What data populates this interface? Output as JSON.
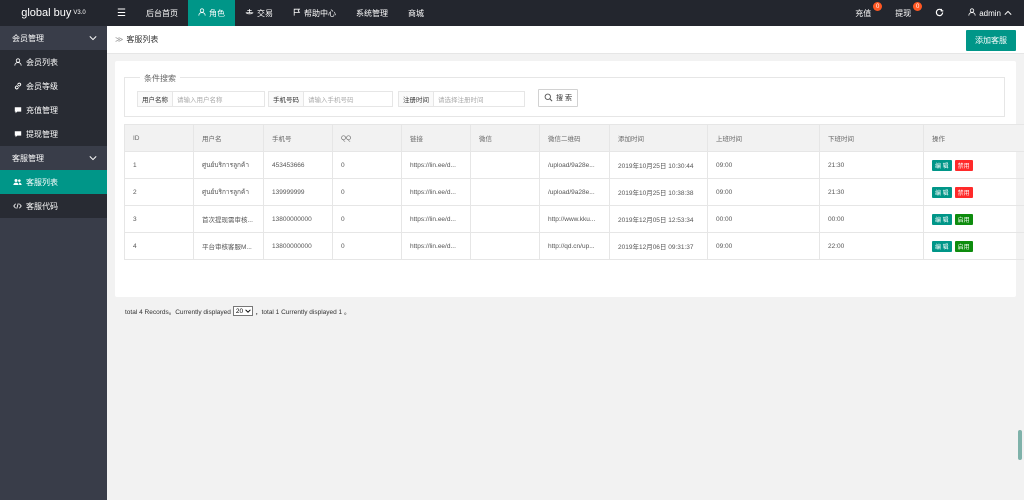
{
  "app": {
    "name": "global buy",
    "version": "V3.0"
  },
  "topnav": {
    "menu_icon": "menu-icon",
    "items": [
      {
        "label": "后台首页",
        "icon": ""
      },
      {
        "label": "角色",
        "icon": "user-icon",
        "active": true
      },
      {
        "label": "交易",
        "icon": "scale-icon"
      },
      {
        "label": "帮助中心",
        "icon": "flag-icon"
      },
      {
        "label": "系统管理",
        "icon": ""
      },
      {
        "label": "商城",
        "icon": ""
      }
    ]
  },
  "topright": {
    "recharge_label": "充值",
    "recharge_badge": "0",
    "withdraw_label": "提现",
    "withdraw_badge": "0",
    "refresh_icon": "refresh-icon",
    "user_label": "admin"
  },
  "sidebar": {
    "groups": [
      {
        "label": "会员管理",
        "items": [
          {
            "label": "会员列表",
            "icon": "user-icon"
          },
          {
            "label": "会员等级",
            "icon": "link-icon"
          },
          {
            "label": "充值管理",
            "icon": "message-icon"
          },
          {
            "label": "提现管理",
            "icon": "message-icon"
          }
        ]
      },
      {
        "label": "客服管理",
        "items": [
          {
            "label": "客服列表",
            "icon": "users-icon",
            "active": true
          },
          {
            "label": "客服代码",
            "icon": "code-icon"
          }
        ]
      }
    ]
  },
  "breadcrumb": {
    "current": "客服列表"
  },
  "actions": {
    "add_label": "添加客服"
  },
  "search": {
    "legend": "条件搜索",
    "fields": [
      {
        "label": "用户名称",
        "placeholder": "请输入用户名称"
      },
      {
        "label": "手机号码",
        "placeholder": "请输入手机号码"
      },
      {
        "label": "注册时间",
        "placeholder": "请选择注册时间"
      }
    ],
    "button_label": "搜 索"
  },
  "table": {
    "columns": [
      "ID",
      "用户名",
      "手机号",
      "QQ",
      "链接",
      "微信",
      "微信二维码",
      "添加时间",
      "上班时间",
      "下班时间",
      "操作"
    ],
    "rows": [
      {
        "cells": [
          "1",
          "ศูนย์บริการลูกค้า",
          "453453666",
          "0",
          "https://lin.ee/d...",
          "",
          "/upload/9a28e...",
          "2019年10月25日 10:30:44",
          "09:00",
          "21:30"
        ],
        "edit": "编 辑",
        "toggle": "禁用",
        "toggle_kind": "disable"
      },
      {
        "cells": [
          "2",
          "ศูนย์บริการลูกค้า",
          "139999999",
          "0",
          "https://lin.ee/d...",
          "",
          "/upload/9a28e...",
          "2019年10月25日 10:38:38",
          "09:00",
          "21:30"
        ],
        "edit": "编 辑",
        "toggle": "禁用",
        "toggle_kind": "disable"
      },
      {
        "cells": [
          "3",
          "首次提现需审核...",
          "13800000000",
          "0",
          "https://lin.ee/d...",
          "",
          "http://www.kku...",
          "2019年12月05日 12:53:34",
          "00:00",
          "00:00"
        ],
        "edit": "编 辑",
        "toggle": "启用",
        "toggle_kind": "enable"
      },
      {
        "cells": [
          "4",
          "平台审核客服M...",
          "13800000000",
          "0",
          "https://lin.ee/d...",
          "",
          "http://qd.cn/up...",
          "2019年12月06日 09:31:37",
          "09:00",
          "22:00"
        ],
        "edit": "编 辑",
        "toggle": "启用",
        "toggle_kind": "enable"
      }
    ]
  },
  "pager": {
    "text_before": "total 4 Records。Currently displayed",
    "page_size": "20",
    "text_after": "，total 1 Currently displayed 1 。"
  },
  "colors": {
    "accent": "#009688",
    "topbar": "#23262e",
    "sidebar": "#393d49",
    "danger": "#ff2a2a",
    "success": "#0e8c0e"
  }
}
